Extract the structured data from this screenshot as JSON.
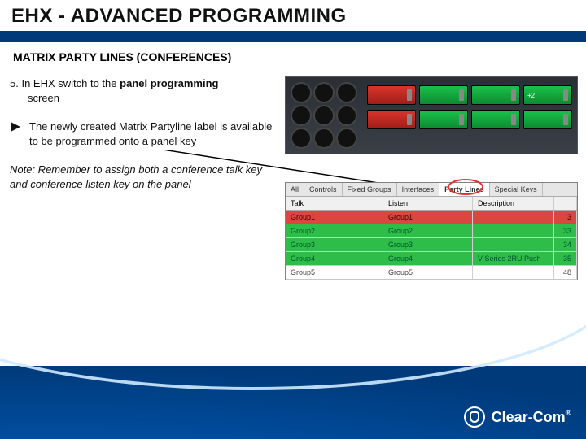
{
  "header": {
    "title": "EHX - ADVANCED PROGRAMMING",
    "subtitle": "MATRIX PARTY LINES (CONFERENCES)"
  },
  "body": {
    "step_lead": "5. In EHX switch to the ",
    "step_bold": "panel programming",
    "step_tail": " screen",
    "bullet": "The newly created Matrix Partyline label is available to be programmed onto a panel key",
    "note_lead": "Note: Remember to assign both a conference talk key and conference listen key on the panel"
  },
  "panel": {
    "keys_row1": [
      "",
      "",
      "",
      "+2"
    ],
    "keys_row2": [
      "",
      "",
      "",
      ""
    ]
  },
  "grid": {
    "tabs": [
      "All",
      "Controls",
      "Fixed Groups",
      "Interfaces",
      "Party Lines",
      "Special Keys"
    ],
    "active_tab": "Party Lines",
    "columns": [
      "Talk",
      "Listen",
      "Description",
      ""
    ],
    "rows": [
      {
        "a": "Group1",
        "b": "Group1",
        "c": "",
        "d": "3",
        "cls": "gr-red"
      },
      {
        "a": "Group2",
        "b": "Group2",
        "c": "",
        "d": "33",
        "cls": "gr-green"
      },
      {
        "a": "Group3",
        "b": "Group3",
        "c": "",
        "d": "34",
        "cls": "gr-green"
      },
      {
        "a": "Group4",
        "b": "Group4",
        "c": "V Series 2RU Push",
        "d": "35",
        "cls": "gr-green"
      },
      {
        "a": "Group5",
        "b": "Group5",
        "c": "",
        "d": "48",
        "cls": "gr-white"
      }
    ]
  },
  "footer": {
    "brand": "Clear-Com",
    "reg": "®"
  }
}
